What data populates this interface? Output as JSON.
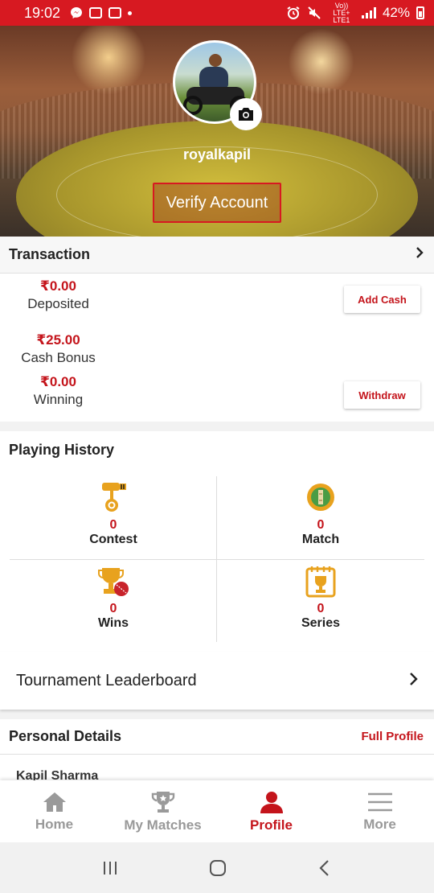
{
  "status_bar": {
    "time": "19:02",
    "network_label": "Vo)) LTE+ LTE1",
    "battery": "42%"
  },
  "profile": {
    "username": "royalkapil",
    "verify_label": "Verify Account"
  },
  "transaction": {
    "title": "Transaction",
    "items": [
      {
        "amount": "₹0.00",
        "label": "Deposited"
      },
      {
        "amount": "₹25.00",
        "label": "Cash Bonus"
      },
      {
        "amount": "₹0.00",
        "label": "Winning"
      }
    ],
    "add_cash_label": "Add Cash",
    "withdraw_label": "Withdraw"
  },
  "playing_history": {
    "title": "Playing History",
    "stats": [
      {
        "value": "0",
        "label": "Contest",
        "icon": "contest-icon"
      },
      {
        "value": "0",
        "label": "Match",
        "icon": "match-icon"
      },
      {
        "value": "0",
        "label": "Wins",
        "icon": "trophy-ball-icon"
      },
      {
        "value": "0",
        "label": "Series",
        "icon": "calendar-trophy-icon"
      }
    ]
  },
  "leaderboard": {
    "title": "Tournament Leaderboard"
  },
  "personal": {
    "title": "Personal Details",
    "full_profile_label": "Full Profile",
    "name": "Kapil Sharma"
  },
  "bottom_nav": [
    {
      "label": "Home",
      "icon": "home-icon"
    },
    {
      "label": "My Matches",
      "icon": "trophy-icon"
    },
    {
      "label": "Profile",
      "icon": "person-icon"
    },
    {
      "label": "More",
      "icon": "menu-icon"
    }
  ],
  "colors": {
    "accent": "#d71921",
    "value_red": "#c4141b",
    "gold": "#e8a21e"
  }
}
